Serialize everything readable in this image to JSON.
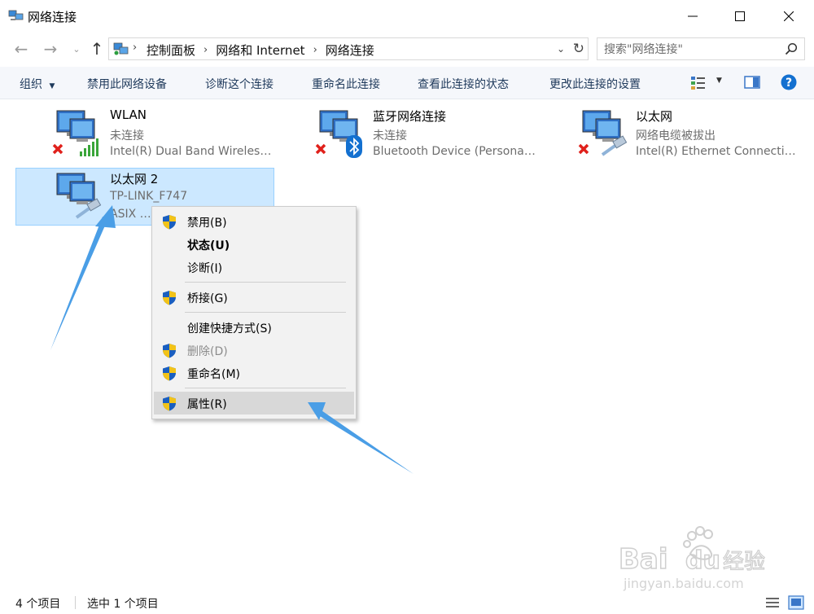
{
  "window": {
    "title": "网络连接"
  },
  "address": {
    "crumbs": [
      "控制面板",
      "网络和 Internet",
      "网络连接"
    ]
  },
  "search": {
    "placeholder": "搜索\"网络连接\""
  },
  "toolbar": {
    "organize": "组织",
    "disable_device": "禁用此网络设备",
    "diagnose": "诊断这个连接",
    "rename": "重命名此连接",
    "view_status": "查看此连接的状态",
    "change_settings": "更改此连接的设置"
  },
  "items": [
    {
      "name": "WLAN",
      "status": "未连接",
      "device": "Intel(R) Dual Band Wireless-AC..."
    },
    {
      "name": "蓝牙网络连接",
      "status": "未连接",
      "device": "Bluetooth Device (Personal Area..."
    },
    {
      "name": "以太网",
      "status": "网络电缆被拔出",
      "device": "Intel(R) Ethernet Connection..."
    },
    {
      "name": "以太网 2",
      "status": "TP-LINK_F747",
      "device": "ASIX AX88179 USB 3.0 to Gigabit..."
    }
  ],
  "context_menu": {
    "items": [
      {
        "label": "禁用(B)"
      },
      {
        "label": "状态(U)"
      },
      {
        "label": "诊断(I)"
      },
      {
        "label": "桥接(G)"
      },
      {
        "label": "创建快捷方式(S)"
      },
      {
        "label": "删除(D)"
      },
      {
        "label": "重命名(M)"
      },
      {
        "label": "属性(R)"
      }
    ]
  },
  "statusbar": {
    "count": "4 个项目",
    "selected": "选中 1 个项目"
  },
  "colors": {
    "accent": "#0078d7",
    "selection_bg": "#cce8ff",
    "arrow": "#4a9ee6"
  }
}
